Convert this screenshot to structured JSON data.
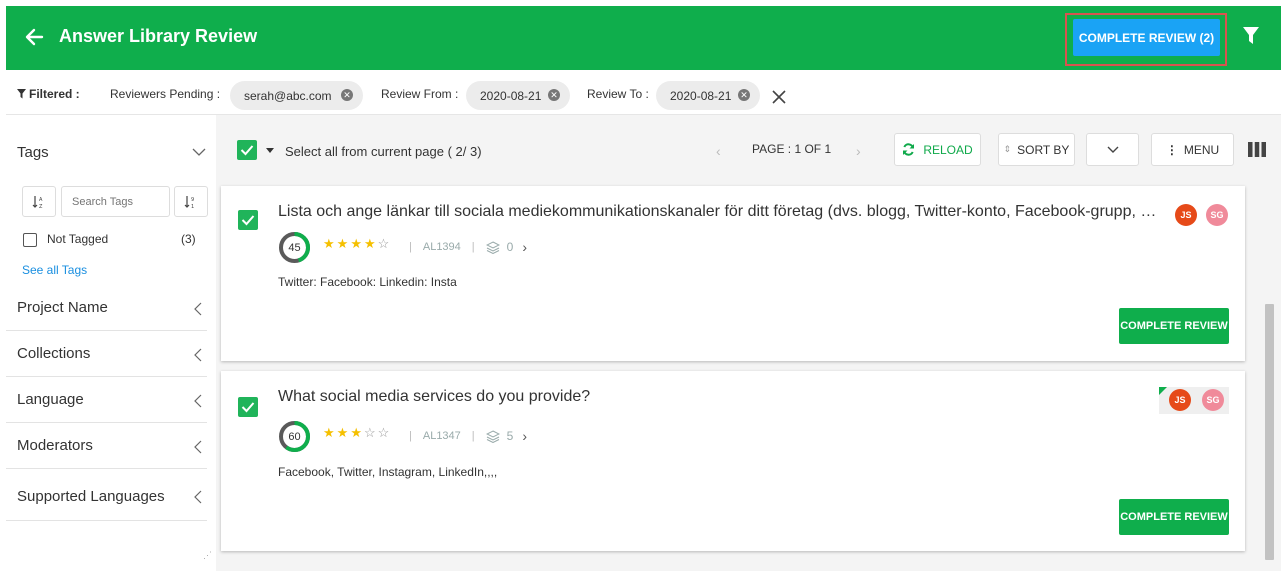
{
  "header": {
    "title": "Answer Library Review",
    "complete_review_label": "COMPLETE REVIEW (2)",
    "accent_color": "#0fae4c",
    "button_color": "#1aa3f5"
  },
  "filters": {
    "label": "Filtered :",
    "reviewers_pending_label": "Reviewers Pending :",
    "reviewers_pending_value": "serah@abc.com",
    "review_from_label": "Review From :",
    "review_from_value": "2020-08-21",
    "review_to_label": "Review To :",
    "review_to_value": "2020-08-21"
  },
  "sidebar": {
    "tags_heading": "Tags",
    "search_placeholder": "Search Tags",
    "not_tagged_label": "Not Tagged",
    "not_tagged_count": "(3)",
    "see_all_label": "See all Tags",
    "sections": [
      {
        "label": "Project Name"
      },
      {
        "label": "Collections"
      },
      {
        "label": "Language"
      },
      {
        "label": "Moderators"
      },
      {
        "label": "Supported Languages"
      }
    ]
  },
  "toolbar": {
    "select_all_label": "Select all from current page",
    "select_count": "( 2/ 3)",
    "page_label": "PAGE : 1 OF 1",
    "reload_label": "RELOAD",
    "sort_label": "SORT BY",
    "menu_label": "MENU"
  },
  "cards": [
    {
      "question": "Lista och ange länkar till sociala mediekommunikationskanaler för ditt företag (dvs. blogg, Twitter-konto, Facebook-grupp, etc.)",
      "score": "45",
      "score_fraction": 0.45,
      "rating": 4,
      "rating_max": 5,
      "id": "AL1394",
      "versions": "0",
      "answer": "Twitter: Facebook: Linkedin: Insta",
      "avatars": [
        "JS",
        "SG"
      ],
      "button_label": "COMPLETE REVIEW"
    },
    {
      "question": "What social media services do you provide?",
      "score": "60",
      "score_fraction": 0.6,
      "rating": 3,
      "rating_max": 5,
      "id": "AL1347",
      "versions": "5",
      "answer": "Facebook, Twitter, Instagram, LinkedIn,,,,",
      "avatars": [
        "JS",
        "SG"
      ],
      "button_label": "COMPLETE REVIEW"
    }
  ]
}
